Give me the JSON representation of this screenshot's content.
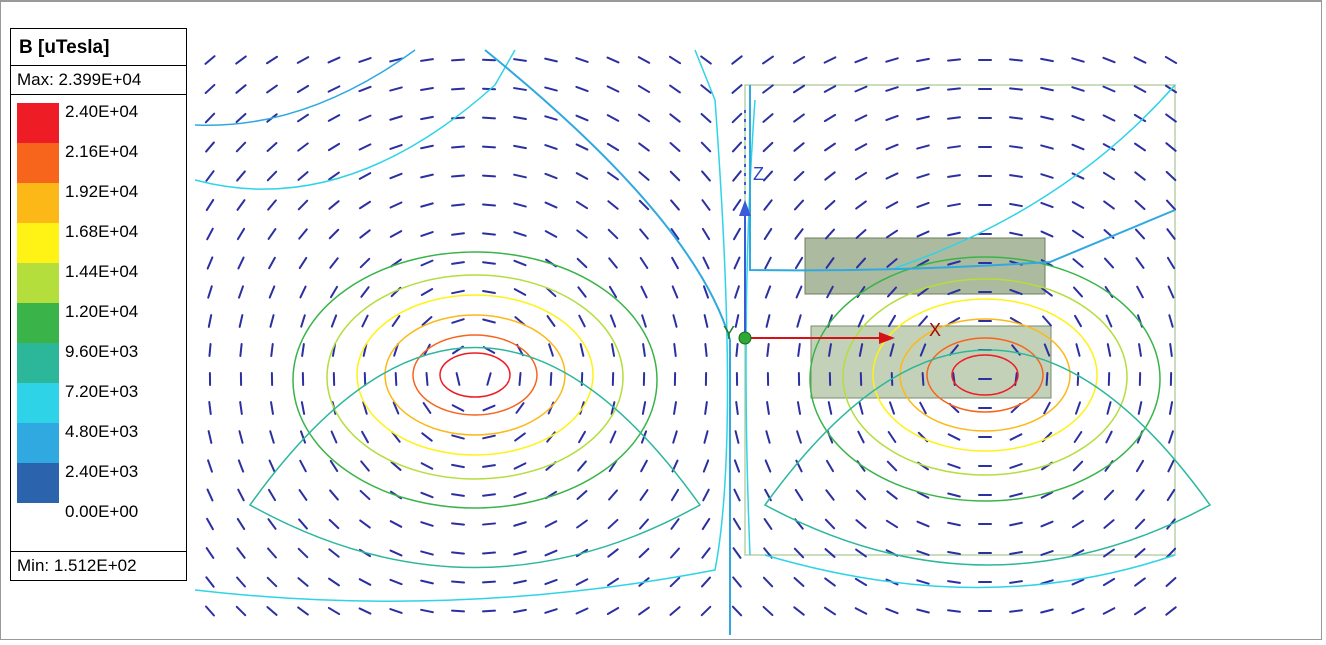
{
  "legend": {
    "title": "B [uTesla]",
    "max_label": "Max: 2.399E+04",
    "min_label": "Min: 1.512E+02",
    "entries": [
      {
        "color": "#ee1c25",
        "label": "2.40E+04"
      },
      {
        "color": "#f6651b",
        "label": "2.16E+04"
      },
      {
        "color": "#fcb817",
        "label": "1.92E+04"
      },
      {
        "color": "#fff215",
        "label": "1.68E+04"
      },
      {
        "color": "#b3de3b",
        "label": "1.44E+04"
      },
      {
        "color": "#3ab449",
        "label": "1.20E+04"
      },
      {
        "color": "#2cb79b",
        "label": "9.60E+03"
      },
      {
        "color": "#2ed3e8",
        "label": "7.20E+03"
      },
      {
        "color": "#30a8e0",
        "label": "4.80E+03"
      },
      {
        "color": "#2b63ad",
        "label": "2.40E+03"
      },
      {
        "color": "#2b2fa1",
        "label": "0.00E+00"
      }
    ]
  },
  "axes": {
    "x": "X",
    "y": "Y",
    "z": "Z"
  },
  "contour_colors": {
    "c1": "#30a8e0",
    "c2": "#2ed3e8",
    "c3": "#2cb79b",
    "c4": "#3ab449",
    "c5": "#b3de3b",
    "c6": "#fff215",
    "c7": "#fcb817",
    "c8": "#f6651b",
    "c9": "#ee1c25"
  }
}
